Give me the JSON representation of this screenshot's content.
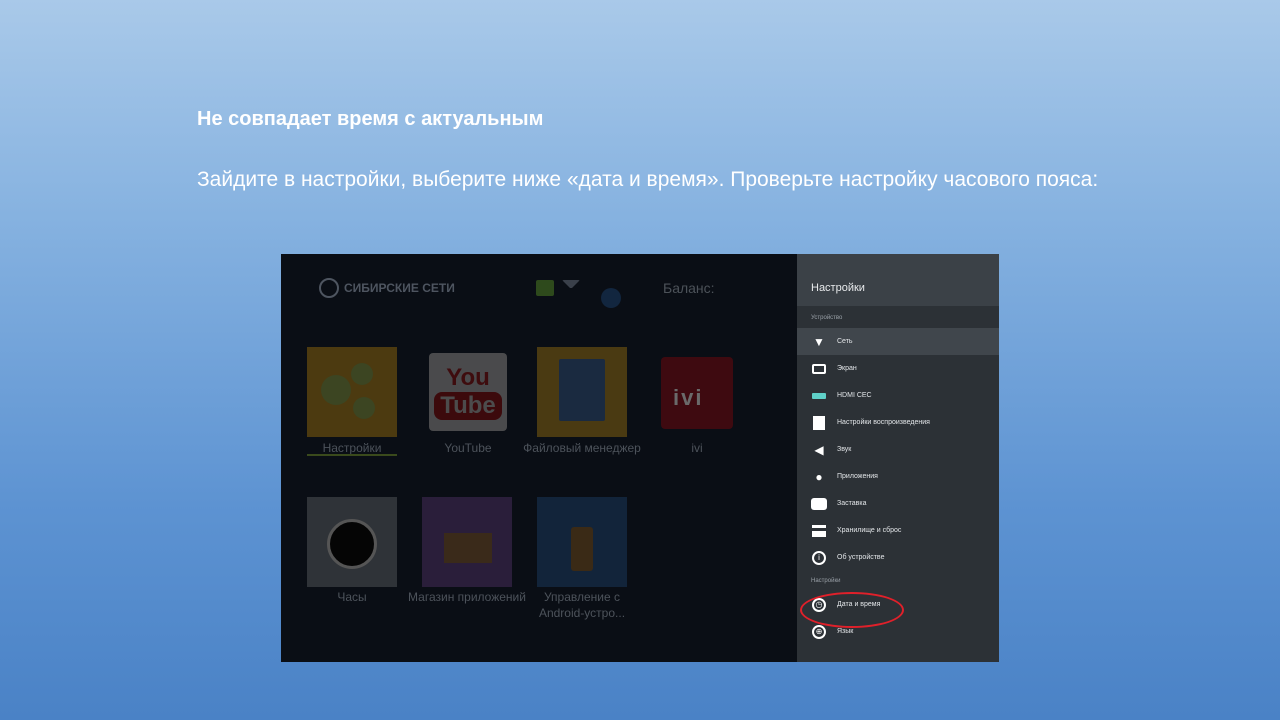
{
  "slide": {
    "heading": "Не совпадает время с актуальным",
    "instruction": "Зайдите в настройки, выберите ниже «дата и время». Проверьте настройку часового пояса:"
  },
  "launcher": {
    "brand": "СИБИРСКИЕ СЕТИ",
    "balance_label": "Баланс:",
    "tiles": [
      {
        "label": "Настройки"
      },
      {
        "label": "YouTube",
        "logo_top": "You",
        "logo_bottom": "Tube"
      },
      {
        "label": "Файловый менеджер"
      },
      {
        "label": "ivi",
        "logo": "ivi"
      },
      {
        "label": "Часы"
      },
      {
        "label": "Магазин приложений"
      },
      {
        "label": "Управление с Android-устро..."
      }
    ]
  },
  "settings_panel": {
    "title": "Настройки",
    "section_device": "Устройство",
    "section_settings": "Настройки",
    "device_items": [
      {
        "label": "Сеть",
        "icon": "wifi-icon"
      },
      {
        "label": "Экран",
        "icon": "screen-icon"
      },
      {
        "label": "HDMI CEC",
        "icon": "hdmi-icon"
      },
      {
        "label": "Настройки воспроизведения",
        "icon": "film-icon"
      },
      {
        "label": "Звук",
        "icon": "speaker-icon"
      },
      {
        "label": "Приложения",
        "icon": "android-icon"
      },
      {
        "label": "Заставка",
        "icon": "screensaver-icon"
      },
      {
        "label": "Хранилище и сброс",
        "icon": "storage-icon"
      },
      {
        "label": "Об устройстве",
        "icon": "info-icon"
      }
    ],
    "settings_items": [
      {
        "label": "Дата и время",
        "icon": "clock-icon"
      },
      {
        "label": "Язык",
        "icon": "globe-icon"
      }
    ]
  },
  "colors": {
    "highlight_ring": "#e0202a",
    "panel_bg": "#2c3136"
  }
}
